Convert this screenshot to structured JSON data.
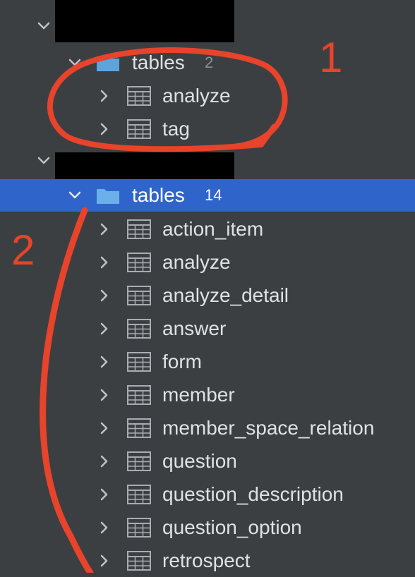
{
  "tree": {
    "groups": [
      {
        "folder_label": "tables",
        "folder_count": "2",
        "items": [
          "analyze",
          "tag"
        ]
      },
      {
        "folder_label": "tables",
        "folder_count": "14",
        "items": [
          "action_item",
          "analyze",
          "analyze_detail",
          "answer",
          "form",
          "member",
          "member_space_relation",
          "question",
          "question_description",
          "question_option",
          "retrospect"
        ]
      }
    ]
  },
  "annotations": {
    "one": "1",
    "two": "2"
  },
  "colors": {
    "background": "#3c3f41",
    "selection": "#2f65ca",
    "folder": "#5aa4e0",
    "annotation": "#e8432b"
  },
  "icons": {
    "expand": "chevron-down-icon",
    "collapsed": "chevron-right-icon",
    "folder": "folder-icon",
    "table": "table-icon"
  }
}
